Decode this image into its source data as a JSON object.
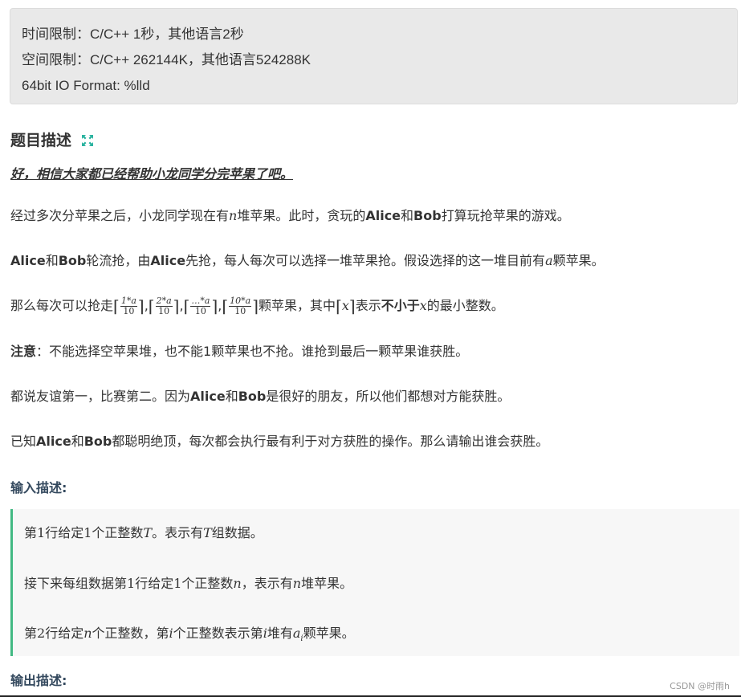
{
  "limits": {
    "time": "时间限制：C/C++ 1秒，其他语言2秒",
    "memory": "空间限制：C/C++ 262144K，其他语言524288K",
    "format": "64bit IO Format: %lld"
  },
  "description": {
    "title": "题目描述",
    "intro": "好，相信大家都已经帮助小龙同学分完苹果了吧。",
    "p1_a": "经过多次分苹果之后，小龙同学现在有",
    "p1_n": "n",
    "p1_b": "堆苹果。此时，贪玩的",
    "p1_alice": "Alice",
    "p1_and": "和",
    "p1_bob": "Bob",
    "p1_c": "打算玩抢苹果的游戏。",
    "p2_alice": "Alice",
    "p2_and": "和",
    "p2_bob": "Bob",
    "p2_a": "轮流抢，由",
    "p2_alice2": "Alice",
    "p2_b": "先抢，每人每次可以选择一堆苹果抢。假设选择的这一堆目前有",
    "p2_var": "a",
    "p2_c": "颗苹果。",
    "p3_a": "那么每次可以抢走",
    "fracs": [
      {
        "num": "1*a",
        "den": "10"
      },
      {
        "num": "2*a",
        "den": "10"
      },
      {
        "num": "…*a",
        "den": "10"
      },
      {
        "num": "10*a",
        "den": "10"
      }
    ],
    "p3_b": "颗苹果，其中",
    "p3_x": "x",
    "p3_c": "表示",
    "p3_bold": "不小于",
    "p3_x2": "x",
    "p3_d": "的最小整数。",
    "p4_bold": "注意",
    "p4": "：不能选择空苹果堆，也不能1颗苹果也不抢。谁抢到最后一颗苹果谁获胜。",
    "p5_a": "都说友谊第一，比赛第二。因为",
    "p5_alice": "Alice",
    "p5_and": "和",
    "p5_bob": "Bob",
    "p5_b": "是很好的朋友，所以他们都想对方能获胜。",
    "p6_a": "已知",
    "p6_alice": "Alice",
    "p6_and": "和",
    "p6_bob": "Bob",
    "p6_b": "都聪明绝顶，每次都会执行最有利于对方获胜的操作。那么请输出谁会获胜。"
  },
  "input": {
    "title": "输入描述:",
    "l1_a": "第",
    "l1_1": "1",
    "l1_b": "行给定",
    "l1_2": "1",
    "l1_c": "个正整数",
    "l1_T": "T",
    "l1_d": "。表示有",
    "l1_T2": "T",
    "l1_e": "组数据。",
    "l2_a": "接下来每组数据第",
    "l2_1": "1",
    "l2_b": "行给定",
    "l2_2": "1",
    "l2_c": "个正整数",
    "l2_n": "n",
    "l2_d": "，表示有",
    "l2_n2": "n",
    "l2_e": "堆苹果。",
    "l3_a": "第",
    "l3_2": "2",
    "l3_b": "行给定",
    "l3_n": "n",
    "l3_c": "个正整数，第",
    "l3_i": "i",
    "l3_d": "个正整数表示第",
    "l3_i2": "i",
    "l3_e": "堆有",
    "l3_a_var": "a",
    "l3_sub": "i",
    "l3_f": "颗苹果。"
  },
  "output": {
    "title": "输出描述:"
  },
  "watermark": "CSDN @时雨h",
  "colors": {
    "accent": "#42b983",
    "box": "#e9e9e9"
  }
}
